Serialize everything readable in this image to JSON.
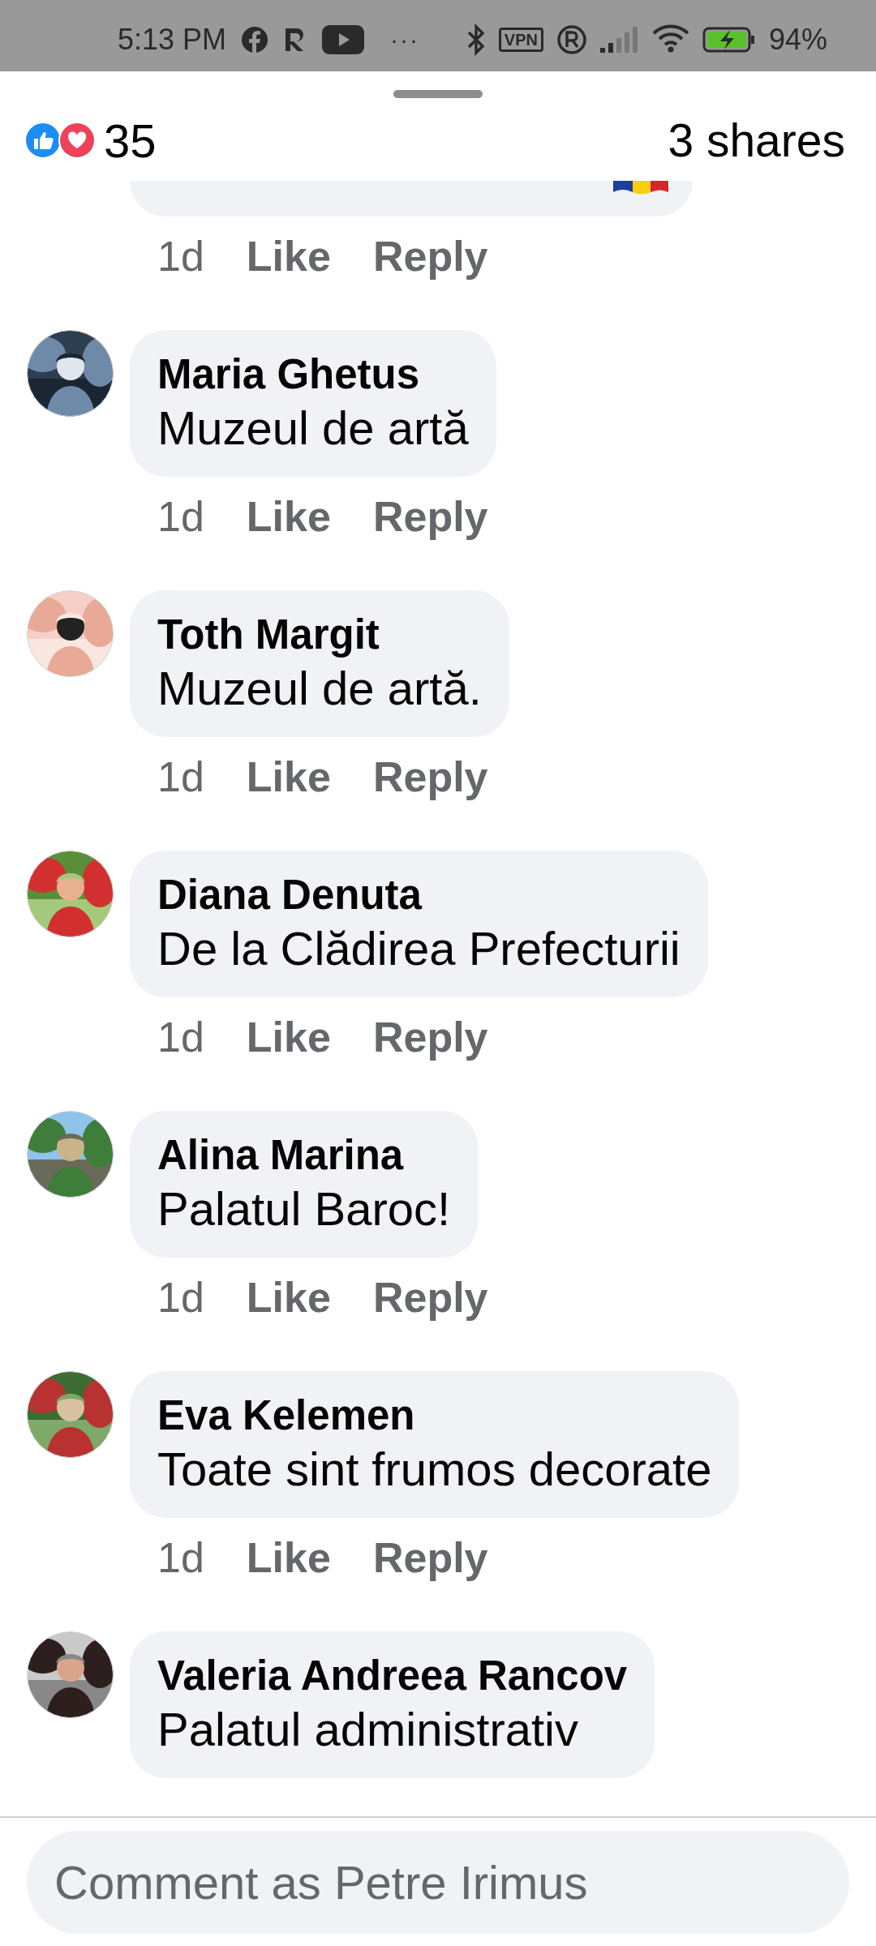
{
  "status_bar": {
    "time": "5:13 PM",
    "more": "···",
    "vpn": "VPN",
    "battery": "94%"
  },
  "header": {
    "reactions_count": "35",
    "shares": "3 shares"
  },
  "comments": [
    {
      "flag": true,
      "time": "1d",
      "like": "Like",
      "reply": "Reply"
    },
    {
      "author": "Maria Ghetus",
      "text": "Muzeul de artă",
      "time": "1d",
      "like": "Like",
      "reply": "Reply"
    },
    {
      "author": "Toth Margit",
      "text": "Muzeul de artă.",
      "time": "1d",
      "like": "Like",
      "reply": "Reply"
    },
    {
      "author": "Diana Denuta",
      "text": "De la Clădirea Prefecturii",
      "time": "1d",
      "like": "Like",
      "reply": "Reply"
    },
    {
      "author": "Alina Marina",
      "text": "Palatul Baroc!",
      "time": "1d",
      "like": "Like",
      "reply": "Reply"
    },
    {
      "author": "Eva Kelemen",
      "text": "Toate sint frumos decorate",
      "time": "1d",
      "like": "Like",
      "reply": "Reply"
    },
    {
      "author": "Valeria Andreea Rancov",
      "text": "Palatul administrativ"
    }
  ],
  "composer": {
    "placeholder": "Comment as Petre Irimus"
  }
}
